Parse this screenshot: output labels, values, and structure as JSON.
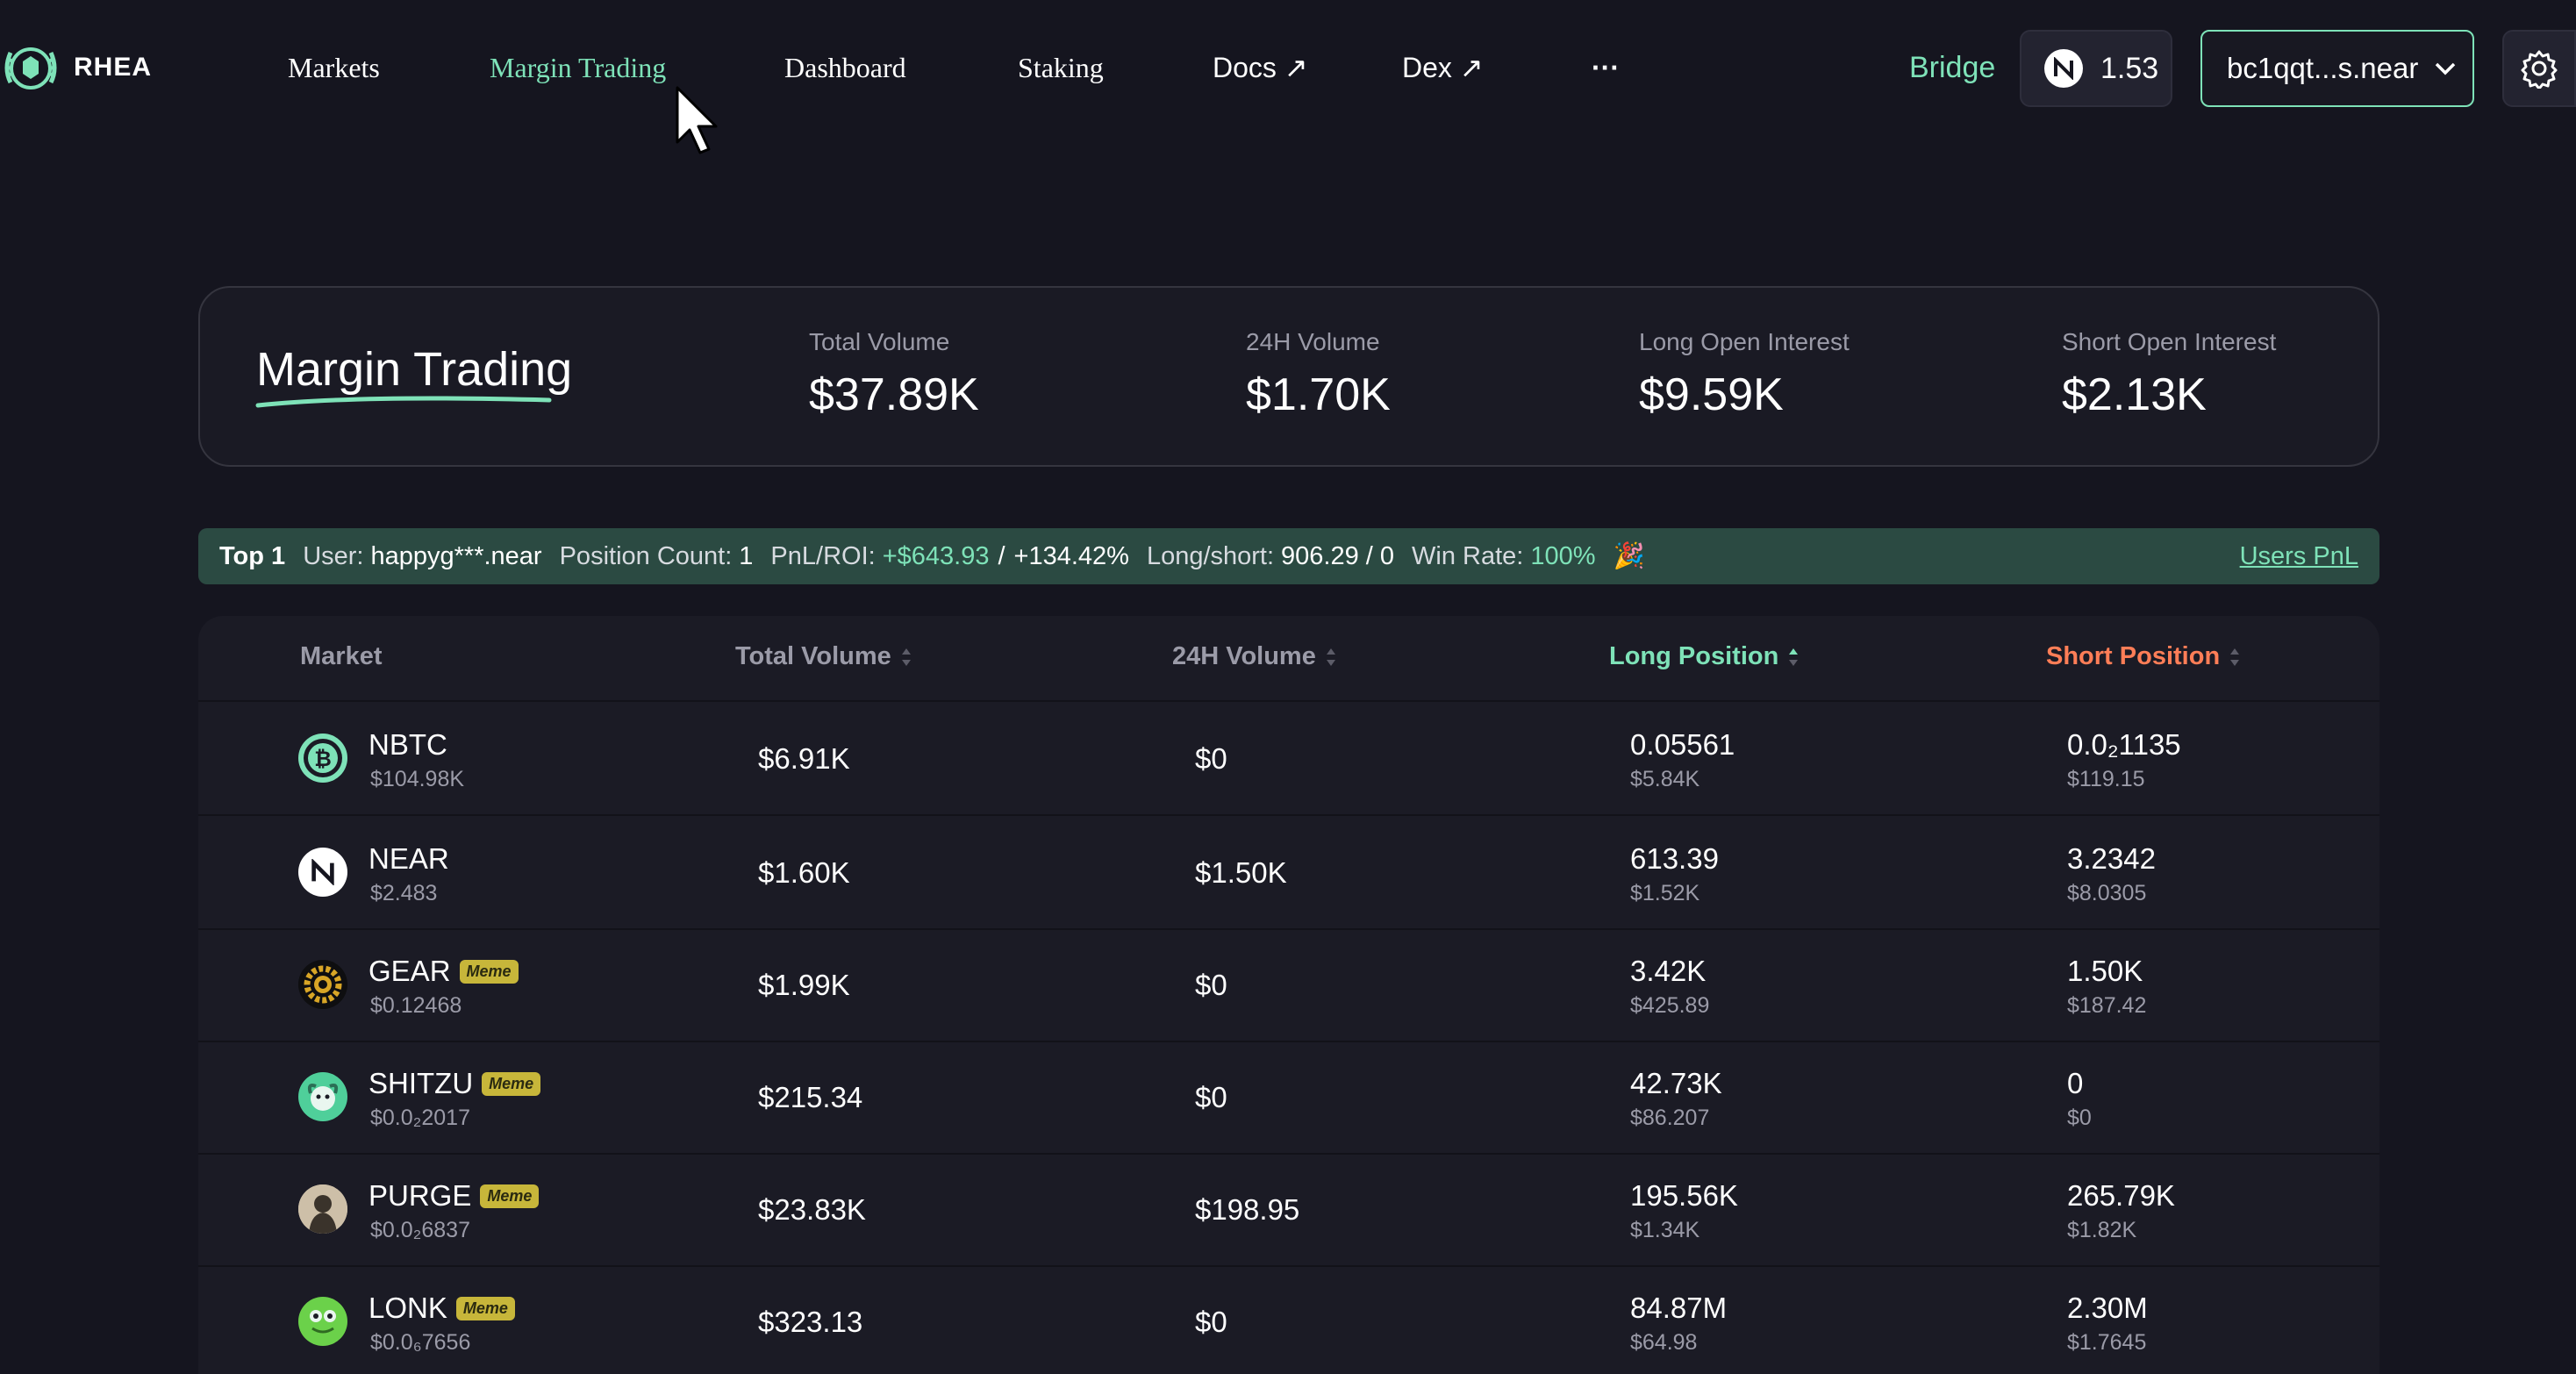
{
  "nav": {
    "logo_text": "RHEA",
    "items": [
      {
        "label": "Markets",
        "active": false
      },
      {
        "label": "Margin Trading",
        "active": true
      },
      {
        "label": "Dashboard",
        "active": false
      },
      {
        "label": "Staking",
        "active": false
      },
      {
        "label": "Docs ↗",
        "active": false
      },
      {
        "label": "Dex ↗",
        "active": false
      },
      {
        "label": "···",
        "active": false
      }
    ],
    "bridge_label": "Bridge",
    "near_balance": "1.53",
    "wallet_address": "bc1qqt...s.near",
    "icons": [
      "rhea-logo-icon",
      "near-icon",
      "chevron-down-icon",
      "gear-icon",
      "mouse-cursor-icon"
    ]
  },
  "stats": {
    "title": "Margin Trading",
    "items": [
      {
        "label": "Total Volume",
        "value": "$37.89K"
      },
      {
        "label": "24H Volume",
        "value": "$1.70K"
      },
      {
        "label": "Long Open Interest",
        "value": "$9.59K"
      },
      {
        "label": "Short Open Interest",
        "value": "$2.13K"
      }
    ]
  },
  "top_user": {
    "rank": "Top 1",
    "user_label": "User:",
    "user": "happyg***.near",
    "position_count_label": "Position Count:",
    "position_count": "1",
    "pnl_label": "PnL/ROI:",
    "pnl": "+$643.93",
    "pnl_sep": "/",
    "roi": "+134.42%",
    "long_short_label": "Long/short:",
    "long_short": "906.29 / 0",
    "win_rate_label": "Win Rate:",
    "win_rate": "100%",
    "emoji": "🎉",
    "users_pnl_link": "Users PnL"
  },
  "table": {
    "headers": {
      "market": "Market",
      "total_volume": "Total Volume",
      "volume_24h": "24H Volume",
      "long_position": "Long Position",
      "short_position": "Short Position"
    },
    "rows": [
      {
        "symbol": "NBTC",
        "meme": false,
        "meme_label": "",
        "price": "$104.98K",
        "total_volume": "$6.91K",
        "volume_24h": "$0",
        "long": "0.05561",
        "long_usd": "$5.84K",
        "short": "0.0₂1135",
        "short_usd": "$119.15",
        "icon": "bitcoin-icon"
      },
      {
        "symbol": "NEAR",
        "meme": false,
        "meme_label": "",
        "price": "$2.483",
        "total_volume": "$1.60K",
        "volume_24h": "$1.50K",
        "long": "613.39",
        "long_usd": "$1.52K",
        "short": "3.2342",
        "short_usd": "$8.0305",
        "icon": "near-icon"
      },
      {
        "symbol": "GEAR",
        "meme": true,
        "meme_label": "Meme",
        "price": "$0.12468",
        "total_volume": "$1.99K",
        "volume_24h": "$0",
        "long": "3.42K",
        "long_usd": "$425.89",
        "short": "1.50K",
        "short_usd": "$187.42",
        "icon": "gear-token-icon"
      },
      {
        "symbol": "SHITZU",
        "meme": true,
        "meme_label": "Meme",
        "price": "$0.0₂2017",
        "total_volume": "$215.34",
        "volume_24h": "$0",
        "long": "42.73K",
        "long_usd": "$86.207",
        "short": "0",
        "short_usd": "$0",
        "icon": "shitzu-dog-icon"
      },
      {
        "symbol": "PURGE",
        "meme": true,
        "meme_label": "Meme",
        "price": "$0.0₂6837",
        "total_volume": "$23.83K",
        "volume_24h": "$198.95",
        "long": "195.56K",
        "long_usd": "$1.34K",
        "short": "265.79K",
        "short_usd": "$1.82K",
        "icon": "purge-avatar-icon"
      },
      {
        "symbol": "LONK",
        "meme": true,
        "meme_label": "Meme",
        "price": "$0.0₆7656",
        "total_volume": "$323.13",
        "volume_24h": "$0",
        "long": "84.87M",
        "long_usd": "$64.98",
        "short": "2.30M",
        "short_usd": "$1.7645",
        "icon": "lonk-frog-icon"
      }
    ]
  },
  "colors": {
    "background": "#15151f",
    "accent_green": "#7ee2b8",
    "short_orange": "#ff7e57",
    "meme_badge": "#c7b63a",
    "top_bar": "#2b4a42"
  }
}
